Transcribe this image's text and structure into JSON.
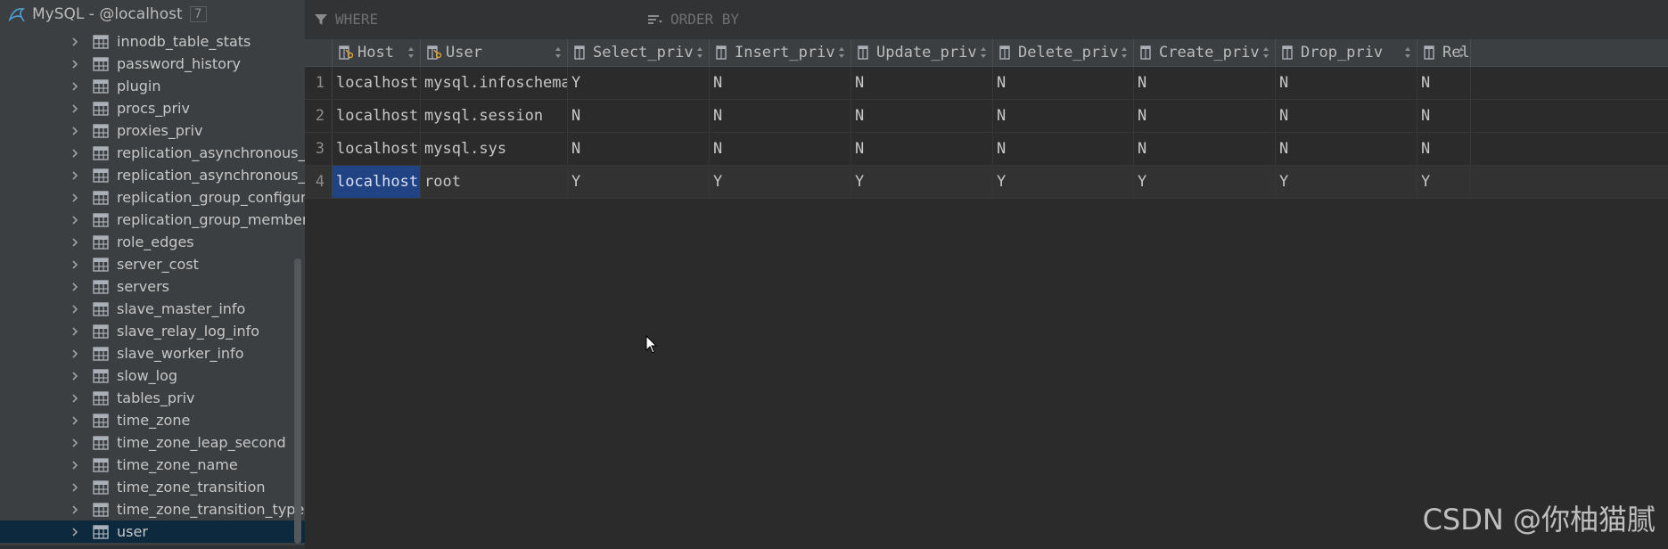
{
  "sidebar": {
    "connection_title": "MySQL - @localhost",
    "connection_count": "7",
    "items": [
      {
        "label": "innodb_table_stats",
        "selected": false
      },
      {
        "label": "password_history",
        "selected": false
      },
      {
        "label": "plugin",
        "selected": false
      },
      {
        "label": "procs_priv",
        "selected": false
      },
      {
        "label": "proxies_priv",
        "selected": false
      },
      {
        "label": "replication_asynchronous_co",
        "selected": false
      },
      {
        "label": "replication_asynchronous_co",
        "selected": false
      },
      {
        "label": "replication_group_configurat",
        "selected": false
      },
      {
        "label": "replication_group_member_a",
        "selected": false
      },
      {
        "label": "role_edges",
        "selected": false
      },
      {
        "label": "server_cost",
        "selected": false
      },
      {
        "label": "servers",
        "selected": false
      },
      {
        "label": "slave_master_info",
        "selected": false
      },
      {
        "label": "slave_relay_log_info",
        "selected": false
      },
      {
        "label": "slave_worker_info",
        "selected": false
      },
      {
        "label": "slow_log",
        "selected": false
      },
      {
        "label": "tables_priv",
        "selected": false
      },
      {
        "label": "time_zone",
        "selected": false
      },
      {
        "label": "time_zone_leap_second",
        "selected": false
      },
      {
        "label": "time_zone_name",
        "selected": false
      },
      {
        "label": "time_zone_transition",
        "selected": false
      },
      {
        "label": "time_zone_transition_type",
        "selected": false
      },
      {
        "label": "user",
        "selected": true
      }
    ]
  },
  "filter": {
    "where_label": "WHERE",
    "order_by_label": "ORDER BY"
  },
  "grid": {
    "columns": [
      "Host",
      "User",
      "Select_priv",
      "Insert_priv",
      "Update_priv",
      "Delete_priv",
      "Create_priv",
      "Drop_priv",
      "Rel"
    ],
    "rows": [
      {
        "num": "1",
        "cells": [
          "localhost",
          "mysql.infoschema",
          "Y",
          "N",
          "N",
          "N",
          "N",
          "N",
          "N"
        ]
      },
      {
        "num": "2",
        "cells": [
          "localhost",
          "mysql.session",
          "N",
          "N",
          "N",
          "N",
          "N",
          "N",
          "N"
        ]
      },
      {
        "num": "3",
        "cells": [
          "localhost",
          "mysql.sys",
          "N",
          "N",
          "N",
          "N",
          "N",
          "N",
          "N"
        ]
      },
      {
        "num": "4",
        "cells": [
          "localhost",
          "root",
          "Y",
          "Y",
          "Y",
          "Y",
          "Y",
          "Y",
          "Y"
        ]
      }
    ],
    "selected_cell": {
      "row": 3,
      "col": 0
    }
  },
  "watermark": "CSDN @你柚猫腻",
  "colors": {
    "background": "#2b2b2b",
    "sidebar": "#3c3f41",
    "selection": "#214283",
    "tree_selected": "#0d293e"
  }
}
